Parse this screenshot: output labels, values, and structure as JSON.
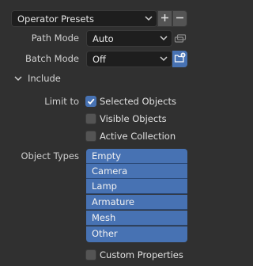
{
  "presets": {
    "value": "Operator Presets",
    "dropdown_icon": "chevron-down-icon",
    "add_icon": "plus-icon",
    "remove_icon": "minus-icon"
  },
  "path_mode": {
    "label": "Path Mode",
    "value": "Auto",
    "dropdown_icon": "chevron-down-icon",
    "extra_icon": "link-icon"
  },
  "batch_mode": {
    "label": "Batch Mode",
    "value": "Off",
    "dropdown_icon": "chevron-down-icon",
    "extra_icon": "new-folder-icon"
  },
  "include": {
    "label": "Include",
    "expanded": true
  },
  "limit_to": {
    "label": "Limit to",
    "options": [
      {
        "label": "Selected Objects",
        "checked": true
      },
      {
        "label": "Visible Objects",
        "checked": false
      },
      {
        "label": "Active Collection",
        "checked": false
      }
    ]
  },
  "object_types": {
    "label": "Object Types",
    "items": [
      "Empty",
      "Camera",
      "Lamp",
      "Armature",
      "Mesh",
      "Other"
    ]
  },
  "custom_properties": {
    "label": "Custom Properties",
    "checked": false
  },
  "colors": {
    "accent": "#4772b3",
    "background": "#303030",
    "field": "#1e1e1e"
  }
}
